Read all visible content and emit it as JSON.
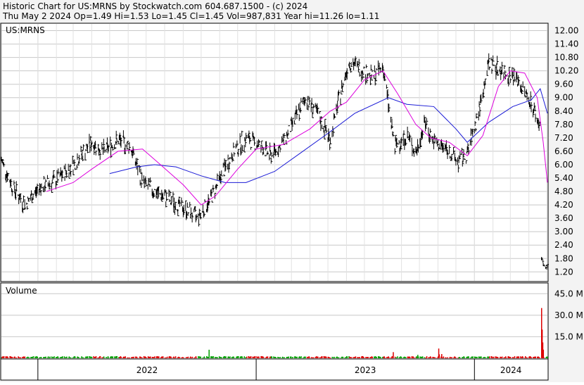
{
  "header": {
    "line1": "Historic Chart for US:MRNS by Stockwatch.com 604.687.1500 - (c) 2024",
    "line2": "Thu May  2 2024  Op=1.49  Hi=1.53  Lo=1.45  Cl=1.45  Vol=987,831  Year hi=11.26  lo=1.11"
  },
  "colors": {
    "background": "#f3f3f3",
    "panel": "#ffffff",
    "grid": "#c8c8c8",
    "price_bars": "#000000",
    "ma_short": "#dd00dd",
    "ma_long": "#1a1ad6",
    "volume_up": "#00a000",
    "volume_down": "#dd0000"
  },
  "chart_data": {
    "type": "line",
    "symbol_label": "US:MRNS",
    "volume_label": "Volume",
    "price_axis": {
      "ylim": [
        0.8,
        12.3
      ],
      "ticks": [
        "12.00",
        "11.40",
        "10.80",
        "10.20",
        "9.60",
        "9.00",
        "8.40",
        "7.80",
        "7.20",
        "6.60",
        "6.00",
        "5.40",
        "4.80",
        "4.20",
        "3.60",
        "3.00",
        "2.40",
        "1.80",
        "1.20"
      ]
    },
    "volume_axis": {
      "unit": "M",
      "ylim": [
        0,
        52
      ],
      "ticks": [
        "45.0 M",
        "30.0 M",
        "15.0 M"
      ]
    },
    "x_axis": {
      "type": "date",
      "start": "2021-11-01",
      "end": "2024-05-02",
      "year_labels": [
        "2022",
        "2023",
        "2024"
      ],
      "year_starts": [
        "2022-01-01",
        "2023-01-01",
        "2024-01-01"
      ]
    },
    "grid": true,
    "series": [
      {
        "kind": "ohlc",
        "points": [
          [
            "2021-11-01",
            6.2
          ],
          [
            "2021-11-20",
            5.0
          ],
          [
            "2021-12-10",
            4.2
          ],
          [
            "2022-01-05",
            5.0
          ],
          [
            "2022-02-01",
            5.3
          ],
          [
            "2022-03-01",
            6.0
          ],
          [
            "2022-04-01",
            7.0
          ],
          [
            "2022-04-20",
            6.6
          ],
          [
            "2022-05-15",
            7.1
          ],
          [
            "2022-06-05",
            6.8
          ],
          [
            "2022-06-25",
            5.2
          ],
          [
            "2022-07-15",
            4.8
          ],
          [
            "2022-08-10",
            4.4
          ],
          [
            "2022-09-05",
            4.0
          ],
          [
            "2022-09-25",
            3.6
          ],
          [
            "2022-10-15",
            4.4
          ],
          [
            "2022-11-05",
            5.6
          ],
          [
            "2022-11-25",
            6.6
          ],
          [
            "2022-12-15",
            7.2
          ],
          [
            "2023-01-05",
            6.9
          ],
          [
            "2023-01-25",
            6.4
          ],
          [
            "2023-02-15",
            7.0
          ],
          [
            "2023-03-10",
            8.2
          ],
          [
            "2023-03-25",
            9.0
          ],
          [
            "2023-04-15",
            8.2
          ],
          [
            "2023-05-05",
            7.1
          ],
          [
            "2023-05-20",
            9.0
          ],
          [
            "2023-06-05",
            10.6
          ],
          [
            "2023-06-25",
            10.3
          ],
          [
            "2023-07-15",
            9.9
          ],
          [
            "2023-08-01",
            10.4
          ],
          [
            "2023-08-20",
            6.8
          ],
          [
            "2023-09-10",
            7.3
          ],
          [
            "2023-09-25",
            6.5
          ],
          [
            "2023-10-10",
            7.9
          ],
          [
            "2023-10-25",
            7.0
          ],
          [
            "2023-11-15",
            6.7
          ],
          [
            "2023-12-05",
            6.1
          ],
          [
            "2023-12-20",
            6.5
          ],
          [
            "2024-01-10",
            8.6
          ],
          [
            "2024-01-25",
            10.6
          ],
          [
            "2024-02-10",
            10.3
          ],
          [
            "2024-02-25",
            10.1
          ],
          [
            "2024-03-10",
            9.9
          ],
          [
            "2024-03-25",
            9.2
          ],
          [
            "2024-04-05",
            8.8
          ],
          [
            "2024-04-15",
            8.0
          ],
          [
            "2024-04-20",
            7.6
          ],
          [
            "2024-04-22",
            1.9
          ],
          [
            "2024-04-26",
            1.4
          ],
          [
            "2024-05-02",
            1.45
          ]
        ]
      },
      {
        "kind": "moving_average_short",
        "points": [
          [
            "2022-01-15",
            4.8
          ],
          [
            "2022-03-01",
            5.2
          ],
          [
            "2022-04-01",
            5.8
          ],
          [
            "2022-05-15",
            6.6
          ],
          [
            "2022-06-25",
            6.7
          ],
          [
            "2022-07-25",
            6.0
          ],
          [
            "2022-09-01",
            5.1
          ],
          [
            "2022-10-01",
            4.2
          ],
          [
            "2022-10-25",
            4.6
          ],
          [
            "2022-12-01",
            5.8
          ],
          [
            "2023-01-01",
            6.7
          ],
          [
            "2023-02-15",
            6.9
          ],
          [
            "2023-04-01",
            7.6
          ],
          [
            "2023-05-05",
            8.4
          ],
          [
            "2023-06-01",
            8.8
          ],
          [
            "2023-07-01",
            9.8
          ],
          [
            "2023-08-01",
            10.2
          ],
          [
            "2023-08-25",
            9.2
          ],
          [
            "2023-09-25",
            7.8
          ],
          [
            "2023-10-20",
            7.2
          ],
          [
            "2023-11-20",
            7.0
          ],
          [
            "2023-12-20",
            6.4
          ],
          [
            "2024-01-15",
            7.3
          ],
          [
            "2024-02-10",
            9.5
          ],
          [
            "2024-03-01",
            10.2
          ],
          [
            "2024-03-25",
            10.1
          ],
          [
            "2024-04-15",
            9.0
          ],
          [
            "2024-04-25",
            7.0
          ],
          [
            "2024-05-02",
            5.2
          ]
        ]
      },
      {
        "kind": "moving_average_long",
        "points": [
          [
            "2022-05-01",
            5.6
          ],
          [
            "2022-06-15",
            5.9
          ],
          [
            "2022-07-15",
            6.0
          ],
          [
            "2022-08-20",
            5.9
          ],
          [
            "2022-10-01",
            5.5
          ],
          [
            "2022-11-10",
            5.2
          ],
          [
            "2022-12-15",
            5.2
          ],
          [
            "2023-02-01",
            5.7
          ],
          [
            "2023-03-15",
            6.5
          ],
          [
            "2023-05-01",
            7.4
          ],
          [
            "2023-06-15",
            8.3
          ],
          [
            "2023-08-10",
            9.0
          ],
          [
            "2023-09-10",
            8.7
          ],
          [
            "2023-10-25",
            8.6
          ],
          [
            "2023-12-01",
            7.6
          ],
          [
            "2023-12-20",
            7.0
          ],
          [
            "2024-01-25",
            7.9
          ],
          [
            "2024-03-05",
            8.6
          ],
          [
            "2024-04-05",
            8.9
          ],
          [
            "2024-04-20",
            9.4
          ],
          [
            "2024-05-02",
            8.3
          ]
        ]
      }
    ],
    "volume_spikes": [
      [
        "2024-04-22",
        35
      ],
      [
        "2024-04-23",
        20
      ],
      [
        "2024-04-24",
        11
      ],
      [
        "2024-04-25",
        6
      ]
    ]
  }
}
